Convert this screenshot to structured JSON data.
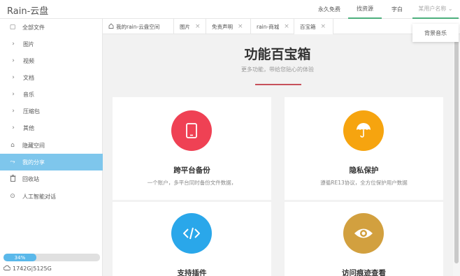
{
  "app": {
    "title": "Rain-云盘"
  },
  "topnav": {
    "items": [
      "永久免费",
      "找资源",
      "字白"
    ],
    "user": "某用户名称 ⌄"
  },
  "dropdown": {
    "item": "背景音乐"
  },
  "sidebar": {
    "items": [
      {
        "label": "全部文件",
        "icon": "file-icon",
        "glyph": "▢"
      },
      {
        "label": "图片",
        "icon": "chevron-right-icon",
        "glyph": "›"
      },
      {
        "label": "视频",
        "icon": "chevron-right-icon",
        "glyph": "›"
      },
      {
        "label": "文档",
        "icon": "chevron-right-icon",
        "glyph": "›"
      },
      {
        "label": "音乐",
        "icon": "chevron-right-icon",
        "glyph": "›"
      },
      {
        "label": "压缩包",
        "icon": "chevron-right-icon",
        "glyph": "›"
      },
      {
        "label": "其他",
        "icon": "chevron-right-icon",
        "glyph": "›"
      },
      {
        "label": "隐藏空间",
        "icon": "lock-icon",
        "glyph": "⌂"
      },
      {
        "label": "我的分享",
        "icon": "share-icon",
        "glyph": "⤳"
      },
      {
        "label": "回收站",
        "icon": "trash-icon",
        "glyph": "🗑"
      },
      {
        "label": "人工智能对话",
        "icon": "chat-icon",
        "glyph": "⊙"
      }
    ],
    "active_index": 8,
    "storage": {
      "percent_label": "34%",
      "percent": 0.34,
      "usage": "1742G|5125G"
    }
  },
  "tabs": [
    {
      "label": "我的rain-云盘空间",
      "home": true
    },
    {
      "label": "图片",
      "close": "×"
    },
    {
      "label": "免责声明",
      "close": "×"
    },
    {
      "label": "rain-商城",
      "close": "×"
    },
    {
      "label": "百宝箱",
      "close": "×",
      "active": true
    }
  ],
  "main": {
    "title": "功能百宝箱",
    "subtitle": "更多功能，带给您贴心的体验",
    "cards": [
      {
        "title": "跨平台备份",
        "desc": "一个账户，多平台同时备份文件数据，",
        "icon": "tablet-icon",
        "color": "#ef4154"
      },
      {
        "title": "隐私保护",
        "desc": "遵循RE13协议，全方位保护用户数据",
        "icon": "umbrella-icon",
        "color": "#f6a40f"
      },
      {
        "title": "支持插件",
        "desc": "",
        "icon": "code-icon",
        "color": "#2aa7ea"
      },
      {
        "title": "访问痕迹查看",
        "desc": "",
        "icon": "eye-icon",
        "color": "#d2a03f"
      }
    ]
  },
  "colors": {
    "accent_green": "#4caf7d",
    "sidebar_active": "#7ec6ec",
    "progress": "#5ab8ea",
    "title_underline": "#c7515b"
  }
}
